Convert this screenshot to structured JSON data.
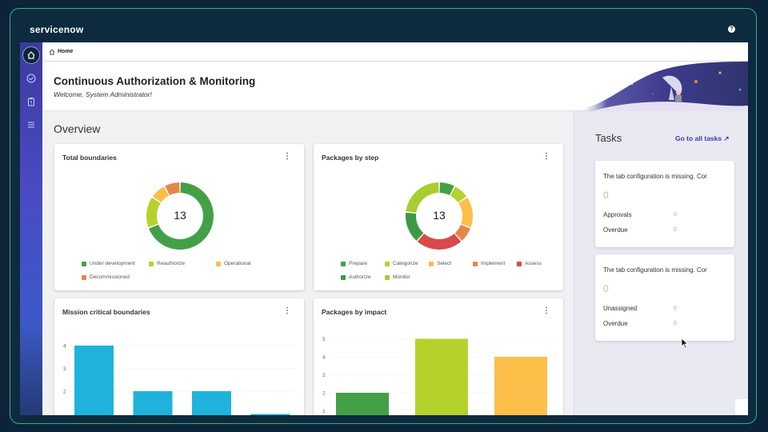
{
  "brand": {
    "logo": "servicenow"
  },
  "breadcrumb": {
    "label": "Home"
  },
  "hero": {
    "title": "Continuous Authorization & Monitoring",
    "welcome": "Welcome, System Administrator!"
  },
  "overview": {
    "title": "Overview"
  },
  "cards": {
    "total_boundaries": {
      "title": "Total boundaries",
      "center": "13",
      "legend": [
        "Under development",
        "Reauthorize",
        "Operational",
        "Decommissioned"
      ],
      "colors": [
        "#43a047",
        "#b5d22c",
        "#fbbf4a",
        "#e8854a"
      ],
      "values": [
        9,
        2,
        1,
        1
      ]
    },
    "packages_by_step": {
      "title": "Packages by step",
      "center": "13",
      "legend": [
        "Prepare",
        "Categorize",
        "Select",
        "Implement",
        "Assess",
        "Authorize",
        "Monitor"
      ],
      "colors": [
        "#43a047",
        "#b5d22c",
        "#fbbf4a",
        "#e8854a",
        "#d94a4a",
        "#3c9a46",
        "#a9cd2d"
      ],
      "values": [
        1,
        1,
        2,
        1,
        3,
        2,
        3
      ]
    },
    "mission_critical": {
      "title": "Mission critical boundaries",
      "ticks": [
        "4",
        "3",
        "2"
      ],
      "values": [
        4,
        2,
        2,
        1
      ],
      "color": "#1fb3dc"
    },
    "packages_by_impact": {
      "title": "Packages by impact",
      "ticks": [
        "5",
        "4",
        "3",
        "2",
        "1"
      ],
      "values": [
        2,
        5,
        4
      ],
      "colors": [
        "#43a047",
        "#b5d22c",
        "#fbbf4a"
      ]
    }
  },
  "tasks": {
    "title": "Tasks",
    "link": "Go to all tasks ↗",
    "cards": [
      {
        "message": "The tab configuration is missing. Cor",
        "count": "0",
        "rows": [
          {
            "label": "Approvals",
            "value": "0"
          },
          {
            "label": "Overdue",
            "value": "0"
          }
        ]
      },
      {
        "message": "The tab configuration is missing. Cor",
        "count": "0",
        "rows": [
          {
            "label": "Unassigned",
            "value": "0"
          },
          {
            "label": "Overdue",
            "value": "0"
          }
        ]
      }
    ]
  },
  "icons": {
    "rail": [
      "home-icon",
      "check-circle-icon",
      "clipboard-icon",
      "list-icon"
    ],
    "help": "help-icon"
  }
}
